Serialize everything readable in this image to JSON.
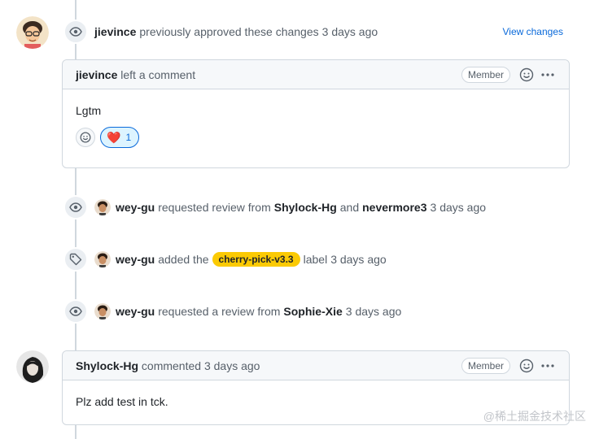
{
  "approval": {
    "user": "jievince",
    "text": "previously approved these changes",
    "time": "3 days ago",
    "link": "View changes"
  },
  "comment1": {
    "user": "jievince",
    "action": "left a comment",
    "badge": "Member",
    "body": "Lgtm",
    "reaction_emoji": "❤️",
    "reaction_count": "1"
  },
  "events": [
    {
      "user": "wey-gu",
      "pre": "requested review from",
      "target1": "Shylock-Hg",
      "and": "and",
      "target2": "nevermore3",
      "time": "3 days ago",
      "icon": "eye-icon"
    },
    {
      "user": "wey-gu",
      "pre": "added the",
      "label": "cherry-pick-v3.3",
      "post": "label",
      "time": "3 days ago",
      "icon": "tag-icon"
    },
    {
      "user": "wey-gu",
      "pre": "requested a review from",
      "target1": "Sophie-Xie",
      "time": "3 days ago",
      "icon": "eye-icon"
    }
  ],
  "comment2": {
    "user": "Shylock-Hg",
    "action": "commented",
    "time": "3 days ago",
    "badge": "Member",
    "body": "Plz add test in tck."
  },
  "watermark": "@稀土掘金技术社区",
  "colors": {
    "label_bg": "#fbca04",
    "link": "#0969da",
    "border": "#d0d7de"
  }
}
